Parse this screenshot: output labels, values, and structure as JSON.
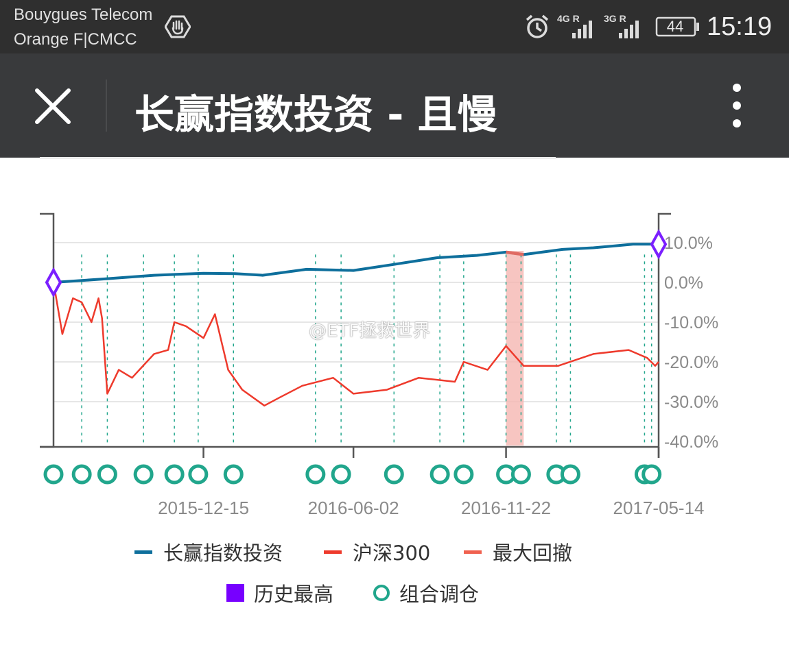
{
  "status_bar": {
    "carrier_primary": "Bouygues Telecom",
    "carrier_secondary": "Orange F|CMCC",
    "network_1": "4G R",
    "network_2": "3G R",
    "battery": "44",
    "time": "15:19",
    "icons": [
      "hand-stop-icon",
      "alarm-clock-icon",
      "signal-4g-icon",
      "signal-3g-icon",
      "battery-icon"
    ]
  },
  "app_bar": {
    "title": "长赢指数投资 - 且慢",
    "close_icon": "close-icon",
    "more_icon": "more-vertical-icon"
  },
  "watermark": "@ETF拯救世界",
  "colors": {
    "strategy": "#0e6f9c",
    "benchmark": "#ee3a2c",
    "drawdown": "#f5b7b2",
    "high_marker": "#7b1fff",
    "rebalance": "#21a68c"
  },
  "chart_data": {
    "type": "line",
    "x_ticks": [
      "2015-12-15",
      "2016-06-02",
      "2016-11-22",
      "2017-05-14"
    ],
    "x_range": [
      "2015-06-28",
      "2017-05-14"
    ],
    "y_ticks": [
      "10.0%",
      "0.0%",
      "-10.0%",
      "-20.0%",
      "-30.0%",
      "-40.0%"
    ],
    "ylim": [
      -40,
      10
    ],
    "grid": true,
    "series": [
      {
        "name": "长赢指数投资",
        "points": [
          [
            "2015-06-28",
            0
          ],
          [
            "2015-08-20",
            0.8
          ],
          [
            "2015-10-20",
            1.8
          ],
          [
            "2015-12-15",
            2.3
          ],
          [
            "2016-01-20",
            2.2
          ],
          [
            "2016-02-20",
            1.8
          ],
          [
            "2016-04-10",
            3.3
          ],
          [
            "2016-06-02",
            3.0
          ],
          [
            "2016-07-20",
            4.6
          ],
          [
            "2016-09-05",
            6.2
          ],
          [
            "2016-10-20",
            6.8
          ],
          [
            "2016-11-22",
            7.6
          ],
          [
            "2016-12-12",
            7.0
          ],
          [
            "2017-01-25",
            8.3
          ],
          [
            "2017-03-01",
            8.7
          ],
          [
            "2017-04-15",
            9.6
          ],
          [
            "2017-05-14",
            9.6
          ]
        ]
      },
      {
        "name": "沪深300",
        "points": [
          [
            "2015-06-28",
            0
          ],
          [
            "2015-07-08",
            -13
          ],
          [
            "2015-07-20",
            -4
          ],
          [
            "2015-07-30",
            -5
          ],
          [
            "2015-08-10",
            -10
          ],
          [
            "2015-08-18",
            -4
          ],
          [
            "2015-08-22",
            -9
          ],
          [
            "2015-08-28",
            -28
          ],
          [
            "2015-09-10",
            -22
          ],
          [
            "2015-09-25",
            -24
          ],
          [
            "2015-10-20",
            -18
          ],
          [
            "2015-11-05",
            -17
          ],
          [
            "2015-11-12",
            -10
          ],
          [
            "2015-11-25",
            -11
          ],
          [
            "2015-12-15",
            -14
          ],
          [
            "2015-12-28",
            -8
          ],
          [
            "2016-01-12",
            -22
          ],
          [
            "2016-01-28",
            -27
          ],
          [
            "2016-02-22",
            -31
          ],
          [
            "2016-03-10",
            -29
          ],
          [
            "2016-04-05",
            -26
          ],
          [
            "2016-05-10",
            -24
          ],
          [
            "2016-06-02",
            -28
          ],
          [
            "2016-07-10",
            -27
          ],
          [
            "2016-08-15",
            -24
          ],
          [
            "2016-09-25",
            -25
          ],
          [
            "2016-10-05",
            -20
          ],
          [
            "2016-11-01",
            -22
          ],
          [
            "2016-11-22",
            -16
          ],
          [
            "2016-12-12",
            -21
          ],
          [
            "2017-01-20",
            -21
          ],
          [
            "2017-03-01",
            -18
          ],
          [
            "2017-04-10",
            -17
          ],
          [
            "2017-05-01",
            -19
          ],
          [
            "2017-05-10",
            -21
          ],
          [
            "2017-05-14",
            -20
          ]
        ]
      }
    ],
    "max_drawdown": {
      "name": "最大回撤",
      "range": [
        "2016-11-22",
        "2016-12-12"
      ]
    },
    "historical_high": {
      "name": "历史最高",
      "dates": [
        "2015-06-28",
        "2017-05-14"
      ]
    },
    "rebalance": {
      "name": "组合调仓",
      "dates": [
        "2015-06-28",
        "2015-07-30",
        "2015-08-28",
        "2015-10-08",
        "2015-11-12",
        "2015-12-09",
        "2016-01-18",
        "2016-04-20",
        "2016-05-19",
        "2016-07-18",
        "2016-09-08",
        "2016-10-05",
        "2016-11-22",
        "2016-12-09",
        "2017-01-18",
        "2017-02-03",
        "2017-04-28",
        "2017-05-06"
      ]
    }
  },
  "legend": [
    {
      "label": "长赢指数投资",
      "symbol": "line",
      "color": "#0e6f9c"
    },
    {
      "label": "沪深300",
      "symbol": "line",
      "color": "#ee3a2c"
    },
    {
      "label": "最大回撤",
      "symbol": "line",
      "color": "#f0614f"
    },
    {
      "label": "历史最高",
      "symbol": "square",
      "color": "#7b00ff"
    },
    {
      "label": "组合调仓",
      "symbol": "ring",
      "color": "#21a68c"
    }
  ]
}
